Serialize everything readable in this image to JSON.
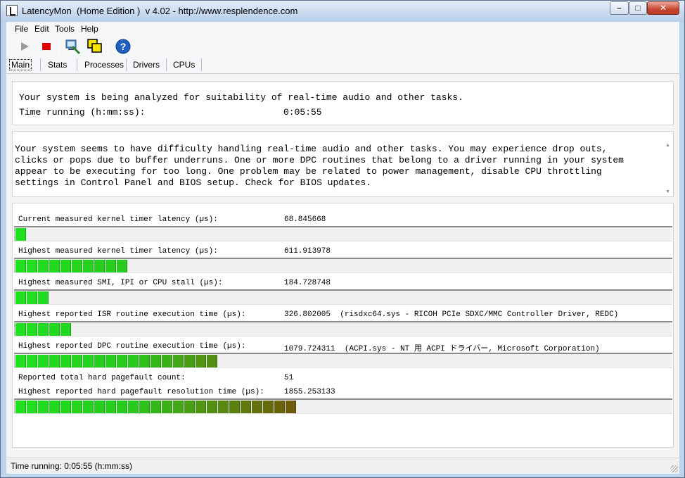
{
  "window": {
    "title": "LatencyMon  (Home Edition )  v 4.02 - http://www.resplendence.com",
    "min_glyph": "–",
    "max_glyph": "□",
    "close_glyph": "✕"
  },
  "menu": [
    {
      "label": "File"
    },
    {
      "label": "Edit"
    },
    {
      "label": "Tools"
    },
    {
      "label": "Help"
    }
  ],
  "toolbar": {
    "icons": [
      "play-icon",
      "stop-icon",
      "computer-icon",
      "windows-icon",
      "help-icon"
    ],
    "colors": {
      "play": "#9a9a9a",
      "stop": "#e00000",
      "help": "#1e5fbf"
    }
  },
  "tabs": [
    {
      "label": "Main"
    },
    {
      "label": "Stats"
    },
    {
      "label": "Processes"
    },
    {
      "label": "Drivers"
    },
    {
      "label": "CPUs"
    }
  ],
  "status_panel": {
    "line1": "Your system is being analyzed for suitability of real-time audio and other tasks.",
    "time_label": "Time running (h:mm:ss):",
    "time_value": "0:05:55"
  },
  "message": {
    "text": "Your system seems to have difficulty handling real-time audio and other tasks. You may experience drop outs, clicks or pops due to buffer underruns. One or more DPC routines that belong to a driver running in your system appear to be executing for too long. One problem may be related to power management, disable CPU throttling settings in Control Panel and BIOS setup. Check for BIOS updates."
  },
  "metrics": [
    {
      "label": "Current measured kernel timer latency (µs):",
      "value": "68.845668",
      "extra": "",
      "segments": 1
    },
    {
      "label": "Highest measured kernel timer latency (µs):",
      "value": "611.913978",
      "extra": "",
      "segments": 10
    },
    {
      "label": "Highest measured SMI, IPI or CPU stall (µs):",
      "value": "184.728748",
      "extra": "",
      "segments": 3
    },
    {
      "label": "Highest reported ISR routine execution time (µs):",
      "value": "326.802005",
      "extra": "(risdxc64.sys - RICOH PCIe SDXC/MMC Controller Driver, REDC)",
      "segments": 5
    },
    {
      "label": "Highest reported DPC routine execution time (µs):",
      "value": "1079.724311",
      "extra": "(ACPI.sys - NT 用 ACPI ドライバー, Microsoft Corporation)",
      "segments": 18
    },
    {
      "label": "Reported total hard pagefault count:",
      "value": "51",
      "extra": ""
    },
    {
      "label": "Highest reported hard pagefault resolution time (µs):",
      "value": "1855.253133",
      "extra": "",
      "segments": 25
    }
  ],
  "statusbar": {
    "text": "Time running: 0:05:55  (h:mm:ss)"
  }
}
